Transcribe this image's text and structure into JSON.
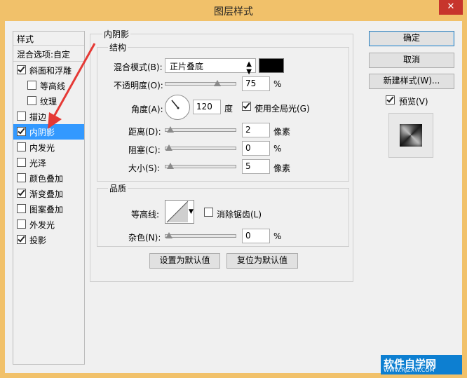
{
  "window": {
    "title": "图层样式",
    "close_glyph": "✕"
  },
  "sidebar": {
    "header": "样式",
    "blend_options": "混合选项:自定",
    "items": [
      {
        "label": "斜面和浮雕",
        "checked": true,
        "indent": false
      },
      {
        "label": "等高线",
        "checked": false,
        "indent": true
      },
      {
        "label": "纹理",
        "checked": false,
        "indent": true
      },
      {
        "label": "描边",
        "checked": false,
        "indent": false
      },
      {
        "label": "内阴影",
        "checked": true,
        "indent": false,
        "selected": true
      },
      {
        "label": "内发光",
        "checked": false,
        "indent": false
      },
      {
        "label": "光泽",
        "checked": false,
        "indent": false
      },
      {
        "label": "颜色叠加",
        "checked": false,
        "indent": false
      },
      {
        "label": "渐变叠加",
        "checked": true,
        "indent": false
      },
      {
        "label": "图案叠加",
        "checked": false,
        "indent": false
      },
      {
        "label": "外发光",
        "checked": false,
        "indent": false
      },
      {
        "label": "投影",
        "checked": true,
        "indent": false
      }
    ]
  },
  "inner_shadow": {
    "section_title": "内阴影",
    "structure": {
      "title": "结构",
      "blend_mode_label": "混合模式(B):",
      "blend_mode_value": "正片叠底",
      "shadow_color": "#000000",
      "opacity_label": "不透明度(O):",
      "opacity_value": "75",
      "opacity_unit": "%",
      "angle_label": "角度(A):",
      "angle_value": "120",
      "angle_unit": "度",
      "global_light_label": "使用全局光(G)",
      "global_light_checked": true,
      "distance_label": "距离(D):",
      "distance_value": "2",
      "distance_unit": "像素",
      "choke_label": "阻塞(C):",
      "choke_value": "0",
      "choke_unit": "%",
      "size_label": "大小(S):",
      "size_value": "5",
      "size_unit": "像素"
    },
    "quality": {
      "title": "品质",
      "contour_label": "等高线:",
      "anti_alias_label": "消除锯齿(L)",
      "anti_alias_checked": false,
      "noise_label": "杂色(N):",
      "noise_value": "0",
      "noise_unit": "%"
    },
    "make_default": "设置为默认值",
    "reset_default": "复位为默认值"
  },
  "sliders": {
    "opacity": 0.75,
    "distance": 0.02,
    "choke": 0.0,
    "size": 0.02,
    "noise": 0.0
  },
  "buttons": {
    "ok": "确定",
    "cancel": "取消",
    "new_style": "新建样式(W)..."
  },
  "preview": {
    "label": "预览(V)",
    "checked": true
  },
  "watermark": {
    "text": "软件自学网",
    "url": "WWW.RJZXW.COM"
  },
  "colors": {
    "title_bar": "#f1c16a",
    "selection": "#3399ff",
    "close": "#c7352c",
    "annotation_arrow": "#e53935"
  }
}
